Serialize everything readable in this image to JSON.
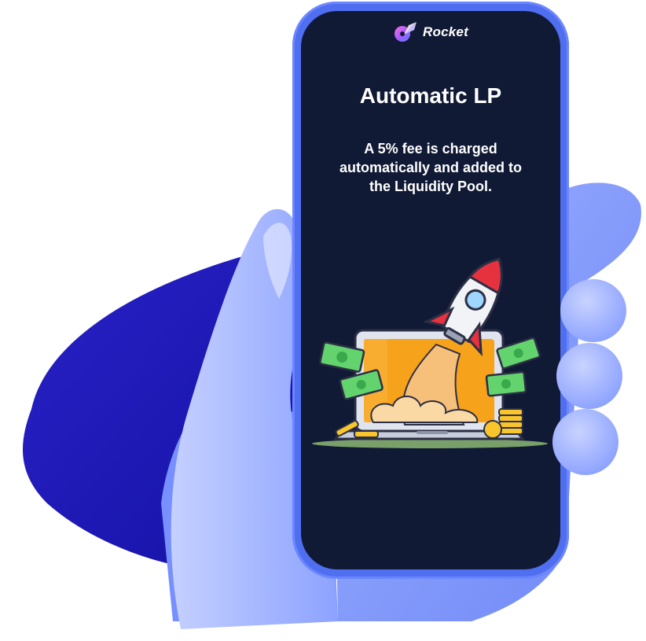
{
  "brand": {
    "name": "Rocket",
    "icon": "rocket-logo-icon"
  },
  "slide": {
    "title": "Automatic LP",
    "description": "A 5% fee is charged automatically and added to the Liquidity Pool."
  },
  "illustration": {
    "icons": [
      "rocket-icon",
      "laptop-icon",
      "money-bill-icon",
      "coin-stack-icon"
    ]
  },
  "colors": {
    "phone_frame": "#4f6ef0",
    "screen_bg": "#111a35",
    "hand": "#7f98ff",
    "backdrop": "#1f1bb8",
    "text": "#ffffff"
  }
}
